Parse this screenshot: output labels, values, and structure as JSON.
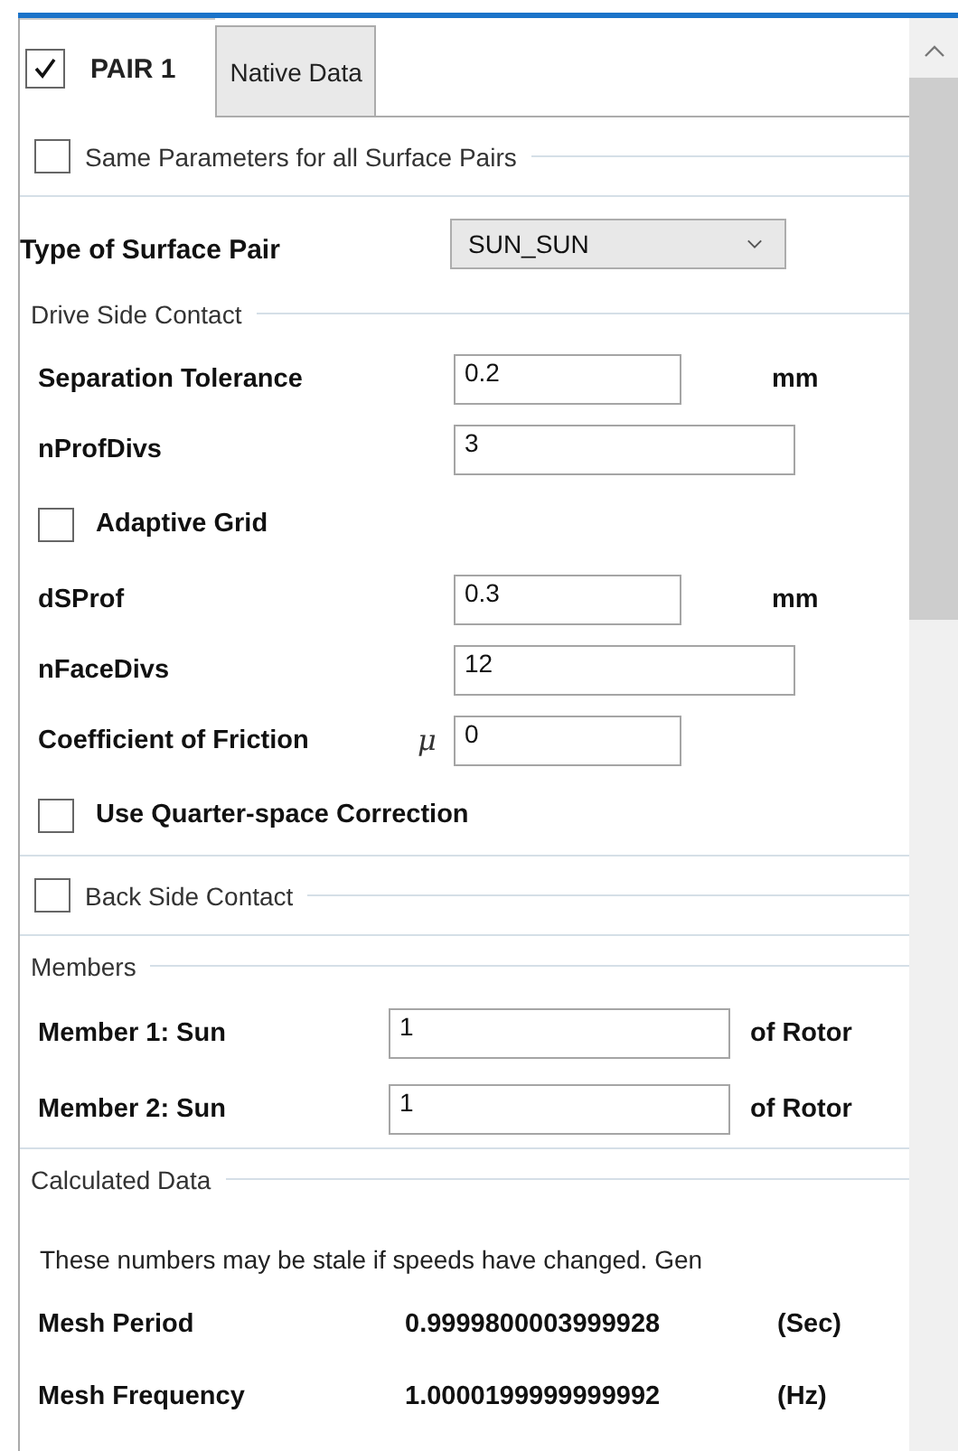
{
  "tabs": [
    {
      "label": "PAIR 1",
      "selected": true,
      "checked": true
    },
    {
      "label": "Native Data",
      "selected": false
    }
  ],
  "same_parameters": {
    "label": "Same Parameters for all Surface Pairs",
    "checked": false
  },
  "surface_pair_type": {
    "label": "Type of Surface Pair",
    "value": "SUN_SUN"
  },
  "drive_side_contact": {
    "title": "Drive Side Contact",
    "rows": [
      {
        "kind": "input",
        "label": "Separation Tolerance",
        "value": "0.2",
        "unit": "mm"
      },
      {
        "kind": "input",
        "label": "nProfDivs",
        "value": "3"
      },
      {
        "kind": "checkbox",
        "label": "Adaptive Grid",
        "checked": false
      },
      {
        "kind": "input",
        "label": "dSProf",
        "value": "0.3",
        "unit": "mm"
      },
      {
        "kind": "input",
        "label": "nFaceDivs",
        "value": "12"
      },
      {
        "kind": "input",
        "label": "Coefficient of Friction",
        "symbol": "μ",
        "value": "0"
      },
      {
        "kind": "checkbox",
        "label": "Use Quarter-space Correction",
        "checked": false
      }
    ]
  },
  "back_side_contact": {
    "label": "Back Side Contact",
    "checked": false
  },
  "members": {
    "title": "Members",
    "rows": [
      {
        "label": "Member 1: Sun",
        "value": "1",
        "unit": "of Rotor"
      },
      {
        "label": "Member 2: Sun",
        "value": "1",
        "unit": "of Rotor"
      }
    ]
  },
  "calculated_data": {
    "title": "Calculated Data",
    "note": "These numbers may be stale if speeds have changed. Gen",
    "rows": [
      {
        "label": "Mesh Period",
        "value": "0.9999800003999928",
        "unit": "(Sec)"
      },
      {
        "label": "Mesh Frequency",
        "value": "1.0000199999999992",
        "unit": "(Hz)"
      }
    ]
  }
}
